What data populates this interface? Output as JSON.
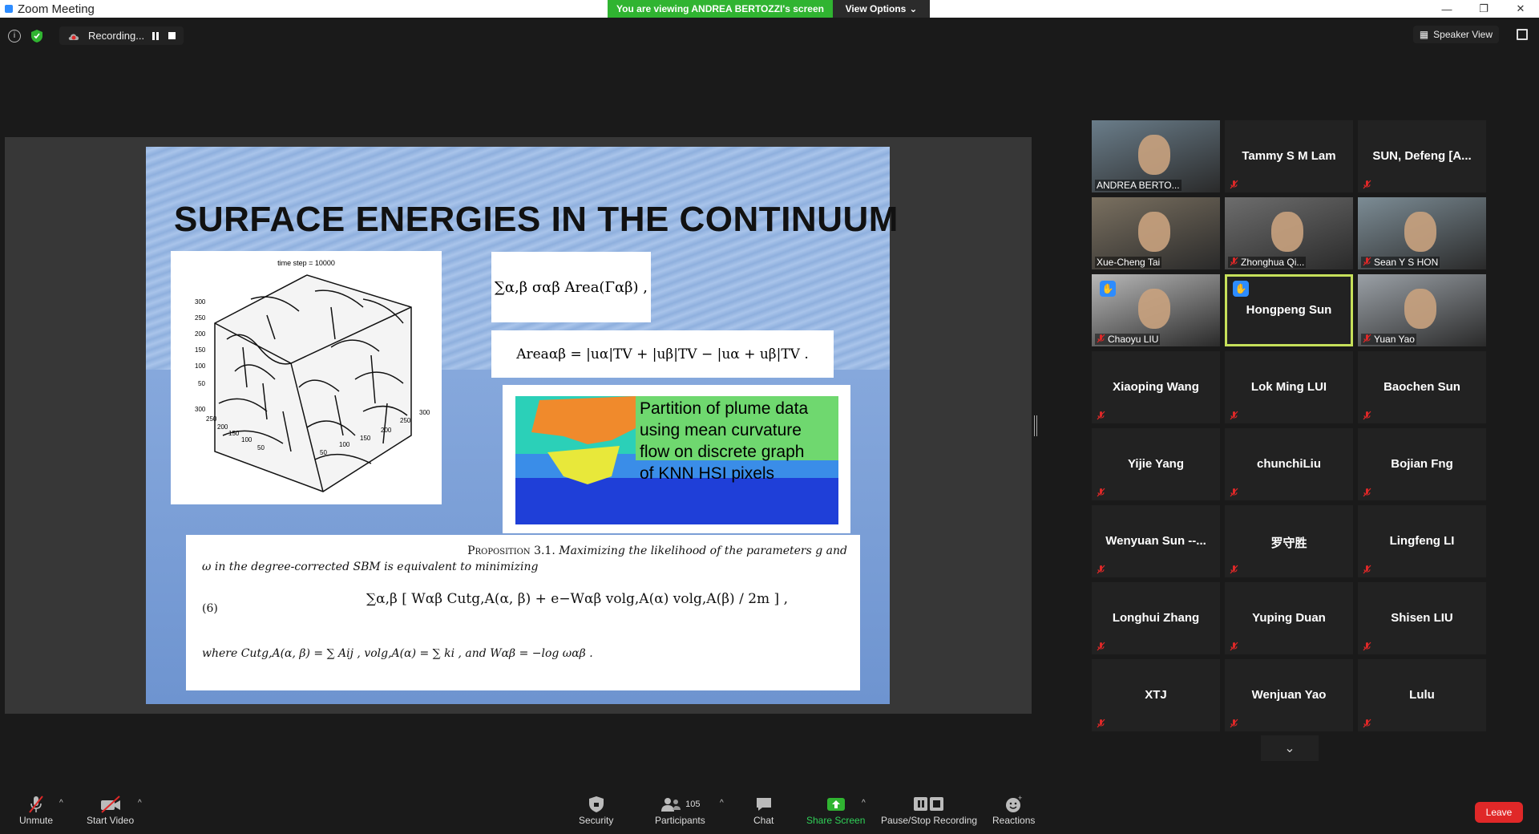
{
  "window": {
    "title": "Zoom Meeting",
    "viewing_banner": "You are viewing ANDREA BERTOZZI's screen",
    "view_options": "View Options",
    "recording_status": "Recording...",
    "speaker_view": "Speaker View"
  },
  "slide": {
    "title": "SURFACE ENERGIES IN THE CONTINUUM",
    "figure_caption": "time step = 10000",
    "eq1": "∑α,β σαβ Area(Γαβ) ,",
    "eq2": "Areaαβ = |uα|TV + |uβ|TV − |uα + uβ|TV .",
    "plume_text_lines": [
      "Partition of plume data",
      "using mean curvature",
      "flow on discrete graph",
      "of KNN HSI pixels"
    ],
    "proposition_label": "Proposition 3.1.",
    "proposition_line1": "Maximizing the likelihood of the parameters g and",
    "proposition_line2": "ω in the degree-corrected SBM is equivalent to minimizing",
    "equation_number": "(6)",
    "main_equation": "∑α,β [ Wαβ Cutg,A(α, β) + e−Wαβ volg,A(α) volg,A(β) / 2m ] ,",
    "where_clause": "where Cutg,A(α, β) = ∑ Aij , volg,A(α) = ∑ ki , and Wαβ = −log ωαβ ."
  },
  "gallery": {
    "participants": [
      {
        "name": "ANDREA BERTO...",
        "video": true,
        "muted": false,
        "hand": false,
        "active": false
      },
      {
        "name": "Tammy S M Lam",
        "video": false,
        "muted": true,
        "hand": false,
        "active": false
      },
      {
        "name": "SUN,  Defeng  [A...",
        "video": false,
        "muted": true,
        "hand": false,
        "active": false
      },
      {
        "name": "Xue-Cheng Tai",
        "video": true,
        "muted": false,
        "hand": false,
        "active": false
      },
      {
        "name": "Zhonghua Qi...",
        "video": true,
        "muted": true,
        "hand": false,
        "active": false
      },
      {
        "name": "Sean Y S HON",
        "video": true,
        "muted": true,
        "hand": false,
        "active": false
      },
      {
        "name": "Chaoyu LIU",
        "video": true,
        "muted": true,
        "hand": true,
        "active": false
      },
      {
        "name": "Hongpeng Sun",
        "video": false,
        "muted": false,
        "hand": true,
        "active": true
      },
      {
        "name": "Yuan Yao",
        "video": true,
        "muted": true,
        "hand": false,
        "active": false
      },
      {
        "name": "Xiaoping Wang",
        "video": false,
        "muted": true,
        "hand": false,
        "active": false
      },
      {
        "name": "Lok Ming LUI",
        "video": false,
        "muted": true,
        "hand": false,
        "active": false
      },
      {
        "name": "Baochen Sun",
        "video": false,
        "muted": true,
        "hand": false,
        "active": false
      },
      {
        "name": "Yijie Yang",
        "video": false,
        "muted": true,
        "hand": false,
        "active": false
      },
      {
        "name": "chunchiLiu",
        "video": false,
        "muted": true,
        "hand": false,
        "active": false
      },
      {
        "name": "Bojian Fng",
        "video": false,
        "muted": true,
        "hand": false,
        "active": false
      },
      {
        "name": "Wenyuan  Sun  --...",
        "video": false,
        "muted": true,
        "hand": false,
        "active": false
      },
      {
        "name": "罗守胜",
        "video": false,
        "muted": true,
        "hand": false,
        "active": false
      },
      {
        "name": "Lingfeng LI",
        "video": false,
        "muted": true,
        "hand": false,
        "active": false
      },
      {
        "name": "Longhui Zhang",
        "video": false,
        "muted": true,
        "hand": false,
        "active": false
      },
      {
        "name": "Yuping Duan",
        "video": false,
        "muted": true,
        "hand": false,
        "active": false
      },
      {
        "name": "Shisen LIU",
        "video": false,
        "muted": true,
        "hand": false,
        "active": false
      },
      {
        "name": "XTJ",
        "video": false,
        "muted": true,
        "hand": false,
        "active": false
      },
      {
        "name": "Wenjuan Yao",
        "video": false,
        "muted": true,
        "hand": false,
        "active": false
      },
      {
        "name": "Lulu",
        "video": false,
        "muted": true,
        "hand": false,
        "active": false
      }
    ]
  },
  "toolbar": {
    "unmute": "Unmute",
    "start_video": "Start Video",
    "security": "Security",
    "participants": "Participants",
    "participants_count": "105",
    "chat": "Chat",
    "share_screen": "Share Screen",
    "pause_stop_recording": "Pause/Stop Recording",
    "reactions": "Reactions",
    "leave": "Leave"
  },
  "colors": {
    "banner_green": "#30b431",
    "share_green": "#30d158",
    "leave_red": "#e02828",
    "active_speaker": "#c6e05a",
    "zoom_blue": "#2d8cff"
  }
}
